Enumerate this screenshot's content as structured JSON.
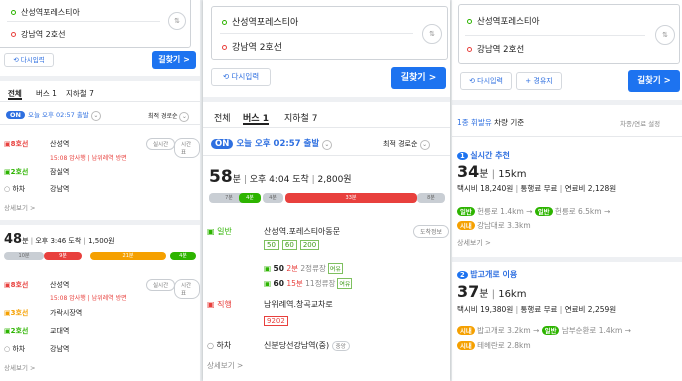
{
  "search": {
    "origin": "산성역포레스티아",
    "destination": "강남역 2호선",
    "reset_label": "다시입력",
    "waypoint_label": "경유지",
    "go_label": "길찾기 >",
    "swap_icon": "⇅"
  },
  "transit": {
    "tabs": [
      "전체",
      "버스 1",
      "지하철 7"
    ],
    "active_tab": "버스 1",
    "on_badge": "ON",
    "departure_text": "오늘 오후 02:57 출발",
    "sort_label": "최적 경로순",
    "p1_route1": {
      "line1": "8호선",
      "line1_station": "산성역",
      "realtime_label": "실시간",
      "timetable_label": "시간표",
      "line1_info": "15:08 암사행 | 남위례역 방면",
      "line2": "2호선",
      "line2_station": "잠실역",
      "alight_label": "하차",
      "alight_station": "강남역",
      "detail_label": "상세보기 >"
    },
    "p1_route2": {
      "minutes": "48",
      "min_unit": "분",
      "arrival": "오후 3:46 도착",
      "fare": "1,500원",
      "timeline": {
        "walk1": "10분",
        "seg1": "9분",
        "seg2": "21분",
        "walk2": "4분"
      },
      "line1": "8호선",
      "line1_station": "산성역",
      "line1_info": "15:08 암사행 | 남위례역 방면",
      "line2": "3호선",
      "line2_station": "가락시장역",
      "line3": "2호선",
      "line3_station": "교대역",
      "alight_label": "하차",
      "alight_station": "강남역",
      "detail_label": "상세보기 >"
    },
    "bus_route": {
      "minutes": "58",
      "min_unit": "분",
      "arrival": "오후 4:04 도착",
      "fare": "2,800원",
      "timeline": {
        "walk1": "7분",
        "seg1": "4분",
        "walk2": "4분",
        "seg2": "33분",
        "walk3": "8분"
      },
      "type1": "일반",
      "stop1": "산성역.포레스티아동문",
      "arrival_info_label": "도착정보",
      "buses": [
        "50",
        "60",
        "200"
      ],
      "bus_arrivals": [
        {
          "no": "50",
          "time": "2분",
          "stops": "2정류장",
          "tag": "여유"
        },
        {
          "no": "60",
          "time": "15분",
          "stops": "11정류장",
          "tag": "여유"
        }
      ],
      "type2": "직행",
      "stop2": "남위례역.창곡교차로",
      "bus2": "9202",
      "alight_label": "하차",
      "alight_stop": "신분당선강남역(중)",
      "alight_tag": "중앙",
      "detail_label": "상세보기 >"
    }
  },
  "car": {
    "header_prefix": "1종 휘발유",
    "header_suffix": "차량 기준",
    "settings_label": "차종/연료 설정",
    "route1": {
      "num": "1",
      "title": "실시간 추천",
      "minutes": "34",
      "min_unit": "분",
      "distance": "15km",
      "taxi": "택시비 18,240원",
      "toll": "통행료 무료",
      "fuel": "연료비 2,128원",
      "road1_badge": "일반",
      "road1": "헌릉로 1.4km",
      "road2_badge": "일반",
      "road2": "헌릉로 6.5km",
      "road3_badge": "시내",
      "road3": "강남대로 3.3km",
      "detail_label": "상세보기 >"
    },
    "route2": {
      "num": "2",
      "title": "밥고개로 이용",
      "minutes": "37",
      "min_unit": "분",
      "distance": "16km",
      "taxi": "택시비 19,380원",
      "toll": "통행료 무료",
      "fuel": "연료비 2,259원",
      "road1_badge": "시내",
      "road1": "밥고개로 3.2km",
      "road2_badge": "일반",
      "road2": "남부순환로 1.4km",
      "road3_badge": "시내",
      "road3": "테헤란로 2.8km"
    }
  },
  "colors": {
    "blue": "#1d73f0",
    "green": "#2db400",
    "red": "#e8403d",
    "orange": "#f5a000"
  }
}
